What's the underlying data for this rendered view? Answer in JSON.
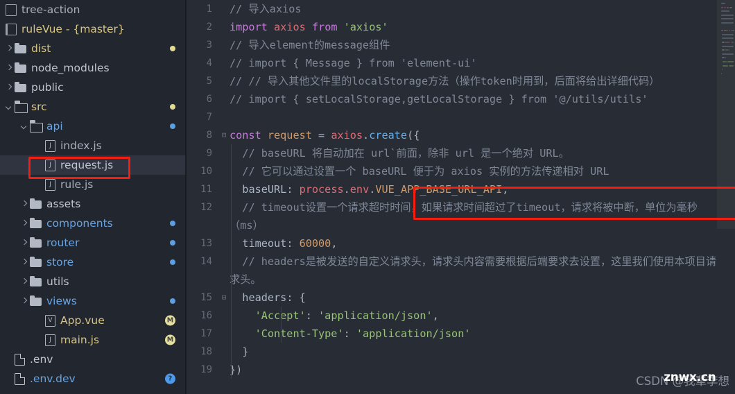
{
  "window": {
    "theme_background": "#22262e",
    "editor_background": "#282c34",
    "annotation_color": "#f51d10"
  },
  "sidebar": {
    "items": [
      {
        "label": "tree-action",
        "icon": "panel-icon",
        "indent": 0,
        "kind": "header",
        "arrow": "none",
        "color": "gray",
        "badge": ""
      },
      {
        "label": "ruleVue - {master}",
        "icon": "project-icon",
        "indent": 0,
        "kind": "project",
        "arrow": "none",
        "color": "yellow",
        "badge": ""
      },
      {
        "label": "dist",
        "icon": "folder-icon",
        "indent": 0,
        "kind": "folder",
        "arrow": "right",
        "color": "yellow",
        "badge": "dot-yellow"
      },
      {
        "label": "node_modules",
        "icon": "folder-icon",
        "indent": 0,
        "kind": "folder",
        "arrow": "right",
        "color": "white",
        "badge": ""
      },
      {
        "label": "public",
        "icon": "folder-icon",
        "indent": 0,
        "kind": "folder",
        "arrow": "right",
        "color": "white",
        "badge": ""
      },
      {
        "label": "src",
        "icon": "folder-open-icon",
        "indent": 0,
        "kind": "folder",
        "arrow": "down",
        "color": "yellow",
        "badge": "dot-yellow"
      },
      {
        "label": "api",
        "icon": "folder-open-icon",
        "indent": 1,
        "kind": "folder",
        "arrow": "down",
        "color": "blue",
        "badge": "dot-blue"
      },
      {
        "label": "index.js",
        "icon": "js-file-icon",
        "indent": 2,
        "kind": "file",
        "arrow": "none",
        "color": "gray",
        "badge": ""
      },
      {
        "label": "request.js",
        "icon": "js-file-icon",
        "indent": 2,
        "kind": "file",
        "arrow": "none",
        "color": "white",
        "badge": "",
        "selected": true,
        "annotated": true
      },
      {
        "label": "rule.js",
        "icon": "js-file-icon",
        "indent": 2,
        "kind": "file",
        "arrow": "none",
        "color": "gray",
        "badge": ""
      },
      {
        "label": "assets",
        "icon": "folder-icon",
        "indent": 1,
        "kind": "folder",
        "arrow": "right",
        "color": "white",
        "badge": ""
      },
      {
        "label": "components",
        "icon": "folder-icon",
        "indent": 1,
        "kind": "folder",
        "arrow": "right",
        "color": "blue",
        "badge": "dot-blue"
      },
      {
        "label": "router",
        "icon": "folder-icon",
        "indent": 1,
        "kind": "folder",
        "arrow": "right",
        "color": "blue",
        "badge": "dot-blue"
      },
      {
        "label": "store",
        "icon": "folder-icon",
        "indent": 1,
        "kind": "folder",
        "arrow": "right",
        "color": "blue",
        "badge": "dot-blue"
      },
      {
        "label": "utils",
        "icon": "folder-icon",
        "indent": 1,
        "kind": "folder",
        "arrow": "right",
        "color": "white",
        "badge": ""
      },
      {
        "label": "views",
        "icon": "folder-icon",
        "indent": 1,
        "kind": "folder",
        "arrow": "right",
        "color": "blue",
        "badge": "dot-blue"
      },
      {
        "label": "App.vue",
        "icon": "vue-file-icon",
        "indent": 2,
        "kind": "file",
        "arrow": "none",
        "color": "yellow",
        "badge": "circle-m"
      },
      {
        "label": "main.js",
        "icon": "js-file-icon",
        "indent": 2,
        "kind": "file",
        "arrow": "none",
        "color": "yellow",
        "badge": "circle-m"
      },
      {
        "label": ".env",
        "icon": "plain-file-icon",
        "indent": 0,
        "kind": "file",
        "arrow": "none",
        "color": "white",
        "badge": ""
      },
      {
        "label": ".env.dev",
        "icon": "plain-file-icon",
        "indent": 0,
        "kind": "file",
        "arrow": "none",
        "color": "blue",
        "badge": "circle-q"
      }
    ],
    "file_icon_glyphs": {
      "js-file-icon": "J",
      "vue-file-icon": "V"
    },
    "badge_glyphs": {
      "circle-m": "M",
      "circle-q": "?"
    }
  },
  "editor": {
    "file": "request.js",
    "lines": [
      {
        "number": "1",
        "fold": "",
        "tokens": [
          {
            "t": "// 导入axios",
            "c": "com"
          }
        ]
      },
      {
        "number": "2",
        "fold": "",
        "tokens": [
          {
            "t": "import",
            "c": "kw"
          },
          {
            "t": " ",
            "c": "punc"
          },
          {
            "t": "axios",
            "c": "id"
          },
          {
            "t": " ",
            "c": "punc"
          },
          {
            "t": "from",
            "c": "kw"
          },
          {
            "t": " ",
            "c": "punc"
          },
          {
            "t": "'axios'",
            "c": "str"
          }
        ]
      },
      {
        "number": "3",
        "fold": "",
        "tokens": [
          {
            "t": "// 导入element的message组件",
            "c": "com"
          }
        ]
      },
      {
        "number": "4",
        "fold": "",
        "tokens": [
          {
            "t": "// import { Message } from 'element-ui'",
            "c": "com"
          }
        ]
      },
      {
        "number": "5",
        "fold": "",
        "tokens": [
          {
            "t": "// // 导入其他文件里的localStorage方法（操作token时用到，后面将给出详细代码）",
            "c": "com"
          }
        ]
      },
      {
        "number": "6",
        "fold": "",
        "tokens": [
          {
            "t": "// import { setLocalStorage,getLocalStorage } from '@/utils/utils'",
            "c": "com"
          }
        ]
      },
      {
        "number": "7",
        "fold": "",
        "tokens": [
          {
            "t": "",
            "c": "punc"
          }
        ]
      },
      {
        "number": "8",
        "fold": "⊟",
        "tokens": [
          {
            "t": "const",
            "c": "kw"
          },
          {
            "t": " ",
            "c": "punc"
          },
          {
            "t": "request",
            "c": "const"
          },
          {
            "t": " = ",
            "c": "punc"
          },
          {
            "t": "axios",
            "c": "id"
          },
          {
            "t": ".",
            "c": "punc"
          },
          {
            "t": "create",
            "c": "fn"
          },
          {
            "t": "({",
            "c": "punc"
          }
        ]
      },
      {
        "number": "9",
        "fold": "",
        "tokens": [
          {
            "t": "  // baseURL 将自动加在 url`前面，除非 url 是一个绝对 URL。",
            "c": "com"
          }
        ]
      },
      {
        "number": "10",
        "fold": "",
        "tokens": [
          {
            "t": "  // 它可以通过设置一个 baseURL 便于为 axios 实例的方法传递相对 URL",
            "c": "com"
          }
        ]
      },
      {
        "number": "11",
        "fold": "",
        "tokens": [
          {
            "t": "  ",
            "c": "punc"
          },
          {
            "t": "baseURL",
            "c": "prop"
          },
          {
            "t": ": ",
            "c": "punc"
          },
          {
            "t": "process",
            "c": "id"
          },
          {
            "t": ".",
            "c": "punc"
          },
          {
            "t": "env",
            "c": "id"
          },
          {
            "t": ".",
            "c": "punc"
          },
          {
            "t": "VUE_APP_BASE_URL_API",
            "c": "num"
          },
          {
            "t": ",",
            "c": "punc"
          }
        ],
        "annotated": true
      },
      {
        "number": "12",
        "fold": "",
        "tokens": [
          {
            "t": "  // timeout设置一个请求超时时间，如果请求时间超过了timeout，请求将被中断，单位为毫秒（ms）",
            "c": "com"
          }
        ]
      },
      {
        "number": "13",
        "fold": "",
        "tokens": [
          {
            "t": "  ",
            "c": "punc"
          },
          {
            "t": "timeout",
            "c": "prop"
          },
          {
            "t": ": ",
            "c": "punc"
          },
          {
            "t": "60000",
            "c": "num"
          },
          {
            "t": ",",
            "c": "punc"
          }
        ]
      },
      {
        "number": "14",
        "fold": "",
        "tokens": [
          {
            "t": "  // headers是被发送的自定义请求头，请求头内容需要根据后端要求去设置，这里我们使用本项目请求头。",
            "c": "com"
          }
        ]
      },
      {
        "number": "15",
        "fold": "⊟",
        "tokens": [
          {
            "t": "  ",
            "c": "punc"
          },
          {
            "t": "headers",
            "c": "prop"
          },
          {
            "t": ": {",
            "c": "punc"
          }
        ]
      },
      {
        "number": "16",
        "fold": "",
        "tokens": [
          {
            "t": "    ",
            "c": "punc"
          },
          {
            "t": "'Accept'",
            "c": "str"
          },
          {
            "t": ": ",
            "c": "punc"
          },
          {
            "t": "'application/json'",
            "c": "str"
          },
          {
            "t": ",",
            "c": "punc"
          }
        ]
      },
      {
        "number": "17",
        "fold": "",
        "tokens": [
          {
            "t": "    ",
            "c": "punc"
          },
          {
            "t": "'Content-Type'",
            "c": "str"
          },
          {
            "t": ": ",
            "c": "punc"
          },
          {
            "t": "'application/json'",
            "c": "str"
          }
        ]
      },
      {
        "number": "18",
        "fold": "",
        "tokens": [
          {
            "t": "  }",
            "c": "punc"
          }
        ]
      },
      {
        "number": "19",
        "fold": "",
        "tokens": [
          {
            "t": "})",
            "c": "punc"
          }
        ]
      }
    ]
  },
  "watermark": {
    "csdn_text": "CSDN @我辈李想",
    "site_text": "znwx.cn"
  }
}
